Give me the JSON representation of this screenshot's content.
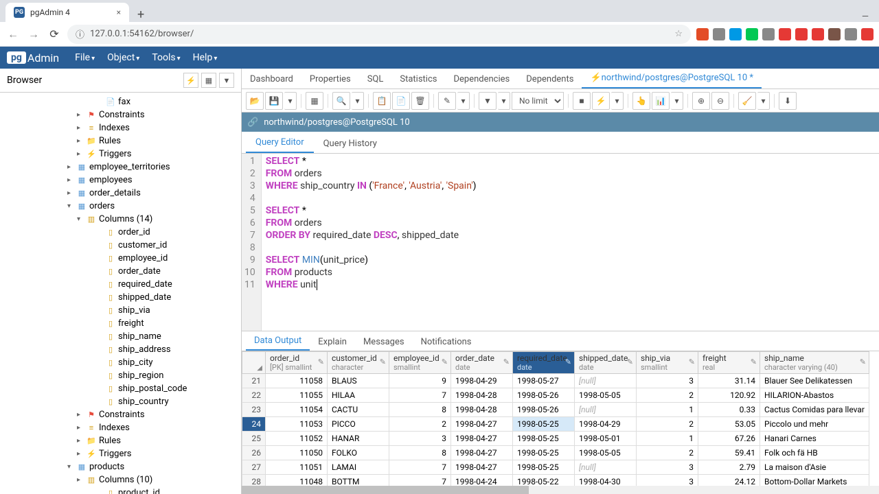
{
  "browser": {
    "tab_title": "pgAdmin 4",
    "url": "127.0.0.1:54162/browser/"
  },
  "menu": {
    "file": "File",
    "object": "Object",
    "tools": "Tools",
    "help": "Help"
  },
  "sidebar": {
    "title": "Browser"
  },
  "tree": [
    {
      "indent": 10,
      "toggle": "",
      "icon": "📄",
      "cls": "icon-table",
      "text": "fax"
    },
    {
      "indent": 8,
      "toggle": "▸",
      "icon": "⚑",
      "cls": "icon-const",
      "text": "Constraints"
    },
    {
      "indent": 8,
      "toggle": "▸",
      "icon": "≡",
      "cls": "icon-col",
      "text": "Indexes"
    },
    {
      "indent": 8,
      "toggle": "▸",
      "icon": "📁",
      "cls": "icon-folder",
      "text": "Rules"
    },
    {
      "indent": 8,
      "toggle": "▸",
      "icon": "⚡",
      "cls": "icon-trig",
      "text": "Triggers"
    },
    {
      "indent": 7,
      "toggle": "▸",
      "icon": "▦",
      "cls": "icon-table",
      "text": "employee_territories"
    },
    {
      "indent": 7,
      "toggle": "▸",
      "icon": "▦",
      "cls": "icon-table",
      "text": "employees"
    },
    {
      "indent": 7,
      "toggle": "▸",
      "icon": "▦",
      "cls": "icon-table",
      "text": "order_details"
    },
    {
      "indent": 7,
      "toggle": "▾",
      "icon": "▦",
      "cls": "icon-table",
      "text": "orders"
    },
    {
      "indent": 8,
      "toggle": "▾",
      "icon": "▥",
      "cls": "icon-col",
      "text": "Columns (14)"
    },
    {
      "indent": 10,
      "toggle": "",
      "icon": "▯",
      "cls": "icon-col",
      "text": "order_id"
    },
    {
      "indent": 10,
      "toggle": "",
      "icon": "▯",
      "cls": "icon-col",
      "text": "customer_id"
    },
    {
      "indent": 10,
      "toggle": "",
      "icon": "▯",
      "cls": "icon-col",
      "text": "employee_id"
    },
    {
      "indent": 10,
      "toggle": "",
      "icon": "▯",
      "cls": "icon-col",
      "text": "order_date"
    },
    {
      "indent": 10,
      "toggle": "",
      "icon": "▯",
      "cls": "icon-col",
      "text": "required_date"
    },
    {
      "indent": 10,
      "toggle": "",
      "icon": "▯",
      "cls": "icon-col",
      "text": "shipped_date"
    },
    {
      "indent": 10,
      "toggle": "",
      "icon": "▯",
      "cls": "icon-col",
      "text": "ship_via"
    },
    {
      "indent": 10,
      "toggle": "",
      "icon": "▯",
      "cls": "icon-col",
      "text": "freight"
    },
    {
      "indent": 10,
      "toggle": "",
      "icon": "▯",
      "cls": "icon-col",
      "text": "ship_name"
    },
    {
      "indent": 10,
      "toggle": "",
      "icon": "▯",
      "cls": "icon-col",
      "text": "ship_address"
    },
    {
      "indent": 10,
      "toggle": "",
      "icon": "▯",
      "cls": "icon-col",
      "text": "ship_city"
    },
    {
      "indent": 10,
      "toggle": "",
      "icon": "▯",
      "cls": "icon-col",
      "text": "ship_region"
    },
    {
      "indent": 10,
      "toggle": "",
      "icon": "▯",
      "cls": "icon-col",
      "text": "ship_postal_code"
    },
    {
      "indent": 10,
      "toggle": "",
      "icon": "▯",
      "cls": "icon-col",
      "text": "ship_country"
    },
    {
      "indent": 8,
      "toggle": "▸",
      "icon": "⚑",
      "cls": "icon-const",
      "text": "Constraints"
    },
    {
      "indent": 8,
      "toggle": "▸",
      "icon": "≡",
      "cls": "icon-col",
      "text": "Indexes"
    },
    {
      "indent": 8,
      "toggle": "▸",
      "icon": "📁",
      "cls": "icon-folder",
      "text": "Rules"
    },
    {
      "indent": 8,
      "toggle": "▸",
      "icon": "⚡",
      "cls": "icon-trig",
      "text": "Triggers"
    },
    {
      "indent": 7,
      "toggle": "▾",
      "icon": "▦",
      "cls": "icon-table",
      "text": "products"
    },
    {
      "indent": 8,
      "toggle": "▸",
      "icon": "▥",
      "cls": "icon-col",
      "text": "Columns (10)"
    },
    {
      "indent": 10,
      "toggle": "",
      "icon": "▯",
      "cls": "icon-col",
      "text": "product_id"
    }
  ],
  "main_tabs": {
    "dashboard": "Dashboard",
    "properties": "Properties",
    "sql": "SQL",
    "statistics": "Statistics",
    "dependencies": "Dependencies",
    "dependents": "Dependents",
    "query": "⚡northwind/postgres@PostgreSQL 10 *"
  },
  "toolbar": {
    "no_limit": "No limit"
  },
  "conn": "northwind/postgres@PostgreSQL 10",
  "editor_tabs": {
    "editor": "Query Editor",
    "history": "Query History"
  },
  "output_tabs": {
    "data": "Data Output",
    "explain": "Explain",
    "messages": "Messages",
    "notifications": "Notifications"
  },
  "columns": [
    {
      "name": "order_id",
      "type": "[PK] smallint",
      "sorted": false
    },
    {
      "name": "customer_id",
      "type": "character",
      "sorted": false
    },
    {
      "name": "employee_id",
      "type": "smallint",
      "sorted": false
    },
    {
      "name": "order_date",
      "type": "date",
      "sorted": false
    },
    {
      "name": "required_date",
      "type": "date",
      "sorted": true
    },
    {
      "name": "shipped_date",
      "type": "date",
      "sorted": false
    },
    {
      "name": "ship_via",
      "type": "smallint",
      "sorted": false
    },
    {
      "name": "freight",
      "type": "real",
      "sorted": false
    },
    {
      "name": "ship_name",
      "type": "character varying (40)",
      "sorted": false
    }
  ],
  "rows": [
    {
      "n": "21",
      "sel": false,
      "v": [
        "11058",
        "BLAUS",
        "9",
        "1998-04-29",
        "1998-05-27",
        "[null]",
        "3",
        "31.14",
        "Blauer See Delikatessen"
      ]
    },
    {
      "n": "22",
      "sel": false,
      "v": [
        "11055",
        "HILAA",
        "7",
        "1998-04-28",
        "1998-05-26",
        "1998-05-05",
        "2",
        "120.92",
        "HILARION-Abastos"
      ]
    },
    {
      "n": "23",
      "sel": false,
      "v": [
        "11054",
        "CACTU",
        "8",
        "1998-04-28",
        "1998-05-26",
        "[null]",
        "1",
        "0.33",
        "Cactus Comidas para llevar"
      ]
    },
    {
      "n": "24",
      "sel": true,
      "v": [
        "11053",
        "PICCO",
        "2",
        "1998-04-27",
        "1998-05-25",
        "1998-04-29",
        "2",
        "53.05",
        "Piccolo und mehr"
      ]
    },
    {
      "n": "25",
      "sel": false,
      "v": [
        "11052",
        "HANAR",
        "3",
        "1998-04-27",
        "1998-05-25",
        "1998-05-01",
        "1",
        "67.26",
        "Hanari Carnes"
      ]
    },
    {
      "n": "26",
      "sel": false,
      "v": [
        "11050",
        "FOLKO",
        "8",
        "1998-04-27",
        "1998-05-25",
        "1998-05-05",
        "2",
        "59.41",
        "Folk och fä HB"
      ]
    },
    {
      "n": "27",
      "sel": false,
      "v": [
        "11051",
        "LAMAI",
        "7",
        "1998-04-27",
        "1998-05-25",
        "[null]",
        "3",
        "2.79",
        "La maison d'Asie"
      ]
    },
    {
      "n": "28",
      "sel": false,
      "v": [
        "11048",
        "BOTTM",
        "7",
        "1998-04-24",
        "1998-05-22",
        "1998-04-30",
        "3",
        "24.12",
        "Bottom-Dollar Markets"
      ]
    }
  ]
}
